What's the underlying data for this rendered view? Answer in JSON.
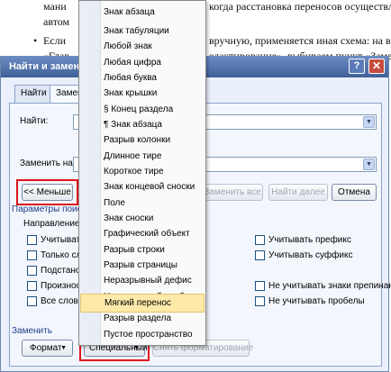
{
  "document": {
    "line1": "мани",
    "line1_tail": "когда расстановка переносов осуществля",
    "line2": "автом",
    "bullet": "•",
    "line3_head": "Если",
    "line3_tail": "вручную, применяется иная схема: на в",
    "line4_head": "«Глав",
    "line4_tail": "едактирование», выбираем пункт «Замен"
  },
  "dialog": {
    "title": "Найти и заменить",
    "help_glyph": "?",
    "close_glyph": "✕",
    "tabs": [
      "Найти",
      "Заменить"
    ],
    "find_label": "Найти:",
    "replace_label": "Заменить на:",
    "less_button": "<< Меньше",
    "replace_all_button": "Заменить все",
    "find_next_button": "Найти далее",
    "cancel_button": "Отмена",
    "search_params": "Параметры поиска",
    "direction_label": "Направление:",
    "options_left": [
      "Учитывать р",
      "Только слово",
      "Подстановоч",
      "Произносится",
      "Все словофор"
    ],
    "options_right": [
      "Учитывать префикс",
      "Учитывать суффикс",
      "Не учитывать знаки препинания",
      "Не учитывать пробелы"
    ],
    "replace_section": "Заменить",
    "format_button": "Формат",
    "special_button": "Специальный",
    "clear_format_button": "Снять форматирование",
    "dropdown_glyph": "▼"
  },
  "special_menu": {
    "items": [
      "Знак абзаца",
      "Знак табуляции",
      "Любой знак",
      "Любая цифра",
      "Любая буква",
      "Знак крышки",
      "§ Конец раздела",
      "¶ Знак абзаца",
      "Разрыв колонки",
      "Длинное тире",
      "Короткое тире",
      "Знак концевой сноски",
      "Поле",
      "Знак сноски",
      "Графический объект",
      "Разрыв строки",
      "Разрыв страницы",
      "Неразрывный дефис",
      "Неразрывный пробел",
      "Мягкий перенос",
      "Разрыв раздела",
      "Пустое пространство"
    ],
    "highlighted": "Мягкий перенос"
  },
  "colors": {
    "highlight_border": "#e0141c",
    "menu_highlight": "#fde9a8",
    "titlebar": "#3f5f99"
  }
}
